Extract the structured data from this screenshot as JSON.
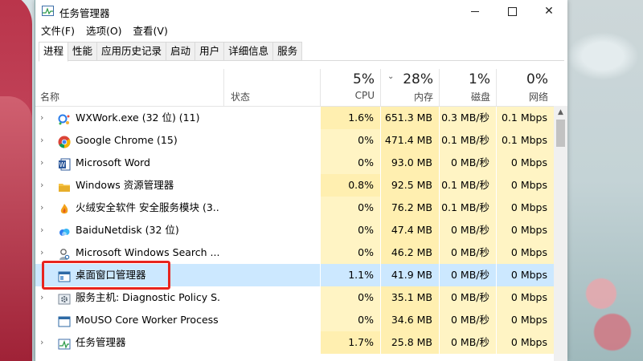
{
  "window": {
    "title": "任务管理器"
  },
  "menu": [
    "文件(F)",
    "选项(O)",
    "查看(V)"
  ],
  "tabs": [
    "进程",
    "性能",
    "应用历史记录",
    "启动",
    "用户",
    "详细信息",
    "服务"
  ],
  "active_tab": 0,
  "columns": {
    "name": "名称",
    "status": "状态",
    "cpu": {
      "pct": "5%",
      "label": "CPU"
    },
    "memory": {
      "pct": "28%",
      "label": "内存"
    },
    "disk": {
      "pct": "1%",
      "label": "磁盘"
    },
    "network": {
      "pct": "0%",
      "label": "网络"
    }
  },
  "rows": [
    {
      "name": "WXWork.exe (32 位) (11)",
      "icon": "wxwork-icon",
      "cpu": "1.6%",
      "mem": "651.3 MB",
      "disk": "0.3 MB/秒",
      "net": "0.1 Mbps",
      "expandable": true
    },
    {
      "name": "Google Chrome (15)",
      "icon": "chrome-icon",
      "cpu": "0%",
      "mem": "471.4 MB",
      "disk": "0.1 MB/秒",
      "net": "0.1 Mbps",
      "expandable": true
    },
    {
      "name": "Microsoft Word",
      "icon": "word-icon",
      "cpu": "0%",
      "mem": "93.0 MB",
      "disk": "0 MB/秒",
      "net": "0 Mbps",
      "expandable": true
    },
    {
      "name": "Windows 资源管理器",
      "icon": "folder-icon",
      "cpu": "0.8%",
      "mem": "92.5 MB",
      "disk": "0.1 MB/秒",
      "net": "0 Mbps",
      "expandable": true
    },
    {
      "name": "火绒安全软件 安全服务模块 (3...",
      "icon": "huorong-icon",
      "cpu": "0%",
      "mem": "76.2 MB",
      "disk": "0.1 MB/秒",
      "net": "0 Mbps",
      "expandable": true
    },
    {
      "name": "BaiduNetdisk (32 位)",
      "icon": "baidu-netdisk-icon",
      "cpu": "0%",
      "mem": "47.4 MB",
      "disk": "0 MB/秒",
      "net": "0 Mbps",
      "expandable": true
    },
    {
      "name": "Microsoft Windows Search ...",
      "icon": "search-user-icon",
      "cpu": "0%",
      "mem": "46.2 MB",
      "disk": "0 MB/秒",
      "net": "0 Mbps",
      "expandable": true
    },
    {
      "name": "桌面窗口管理器",
      "icon": "dwm-window-icon",
      "cpu": "1.1%",
      "mem": "41.9 MB",
      "disk": "0 MB/秒",
      "net": "0 Mbps",
      "expandable": false,
      "selected": true
    },
    {
      "name": "服务主机: Diagnostic Policy S...",
      "icon": "gear-icon",
      "cpu": "0%",
      "mem": "35.1 MB",
      "disk": "0 MB/秒",
      "net": "0 Mbps",
      "expandable": true
    },
    {
      "name": "MoUSO Core Worker Process",
      "icon": "window-icon",
      "cpu": "0%",
      "mem": "34.6 MB",
      "disk": "0 MB/秒",
      "net": "0 Mbps",
      "expandable": false
    },
    {
      "name": "任务管理器",
      "icon": "task-manager-icon",
      "cpu": "1.7%",
      "mem": "25.8 MB",
      "disk": "0 MB/秒",
      "net": "0 Mbps",
      "expandable": true
    }
  ],
  "colors": {
    "heat": "#fff4c4",
    "selected": "#cce8ff",
    "annotation": "#e8251e"
  }
}
